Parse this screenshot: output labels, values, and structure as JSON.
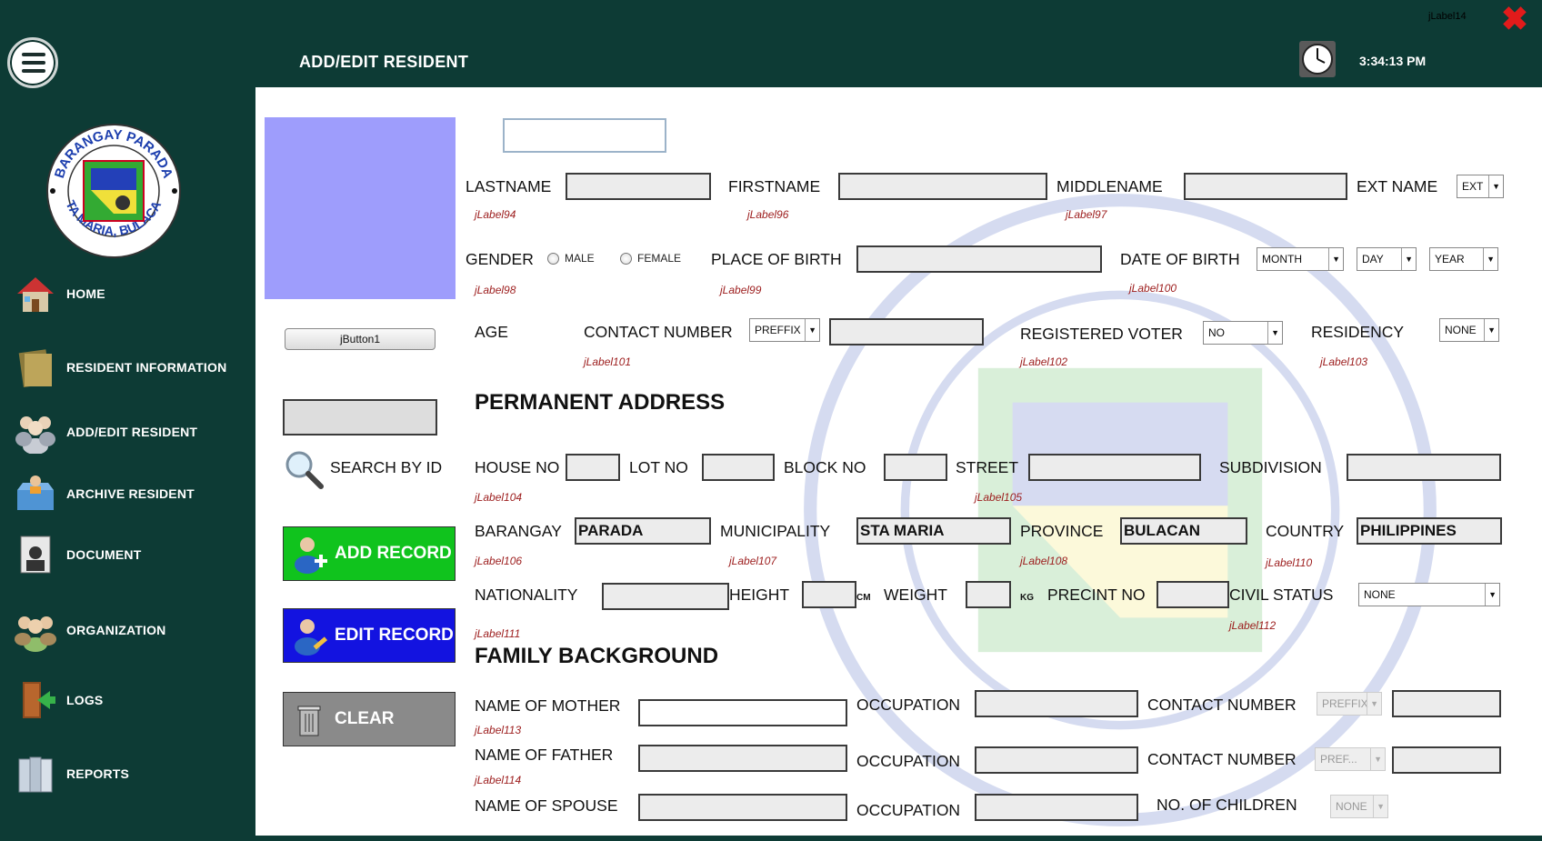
{
  "window": {
    "title": "ADD/EDIT RESIDENT",
    "clock": "3:34:13 PM",
    "corner_label": "jLabel14"
  },
  "logo_text": [
    "BARANGAY PARADA",
    "STA MARIA, BULACAN"
  ],
  "nav": [
    {
      "label": "HOME",
      "icon": "home-icon"
    },
    {
      "label": "RESIDENT INFORMATION",
      "icon": "folder-icon"
    },
    {
      "label": "ADD/EDIT RESIDENT",
      "icon": "users-icon"
    },
    {
      "label": "ARCHIVE RESIDENT",
      "icon": "archive-icon"
    },
    {
      "label": "DOCUMENT",
      "icon": "document-icon"
    },
    {
      "label": "ORGANIZATION",
      "icon": "group-icon"
    },
    {
      "label": "LOGS",
      "icon": "exit-door-icon"
    },
    {
      "label": "REPORTS",
      "icon": "books-icon"
    }
  ],
  "left": {
    "photo_button": "jButton1",
    "search_label": "SEARCH BY ID",
    "add_record": "ADD RECORD",
    "edit_record": "EDIT RECORD",
    "clear": "CLEAR"
  },
  "personal": {
    "lastname": "LASTNAME",
    "firstname": "FIRSTNAME",
    "middlename": "MIDDLENAME",
    "ext_name": "EXT NAME",
    "ext_value": "EXT",
    "jl94": "jLabel94",
    "jl96": "jLabel96",
    "jl97": "jLabel97",
    "gender": "GENDER",
    "male": "MALE",
    "female": "FEMALE",
    "place_of_birth": "PLACE OF BIRTH",
    "date_of_birth": "DATE OF BIRTH",
    "month": "MONTH",
    "day": "DAY",
    "year": "YEAR",
    "jl98": "jLabel98",
    "jl99": "jLabel99",
    "jl100": "jLabel100",
    "age": "AGE",
    "contact_number": "CONTACT NUMBER",
    "prefix": "PREFFIX",
    "registered_voter": "REGISTERED VOTER",
    "voter_value": "NO",
    "residency": "RESIDENCY",
    "residency_value": "NONE",
    "jl101": "jLabel101",
    "jl102": "jLabel102",
    "jl103": "jLabel103"
  },
  "address": {
    "title": "PERMANENT ADDRESS",
    "house_no": "HOUSE NO",
    "lot_no": "LOT NO",
    "block_no": "BLOCK NO",
    "street": "STREET",
    "subdivision": "SUBDIVISION",
    "jl104": "jLabel104",
    "jl105": "jLabel105",
    "barangay": "BARANGAY",
    "barangay_value": "PARADA",
    "municipality": "MUNICIPALITY",
    "municipality_value": "STA MARIA",
    "province": "PROVINCE",
    "province_value": "BULACAN",
    "country": "COUNTRY",
    "country_value": "PHILIPPINES",
    "jl106": "jLabel106",
    "jl107": "jLabel107",
    "jl108": "jLabel108",
    "jl110": "jLabel110",
    "nationality": "NATIONALITY",
    "height": "HEIGHT",
    "cm": "CM",
    "weight": "WEIGHT",
    "kg": "KG",
    "precint_no": "PRECINT NO",
    "civil_status": "CIVIL STATUS",
    "civil_value": "NONE",
    "jl111": "jLabel111",
    "jl112": "jLabel112"
  },
  "family": {
    "title": "FAMILY BACKGROUND",
    "mother": "NAME OF MOTHER",
    "father": "NAME OF FATHER",
    "spouse": "NAME OF SPOUSE",
    "occupation": "OCCUPATION",
    "contact_number": "CONTACT NUMBER",
    "prefix1": "PREFFIX",
    "prefix2": "PREF...",
    "children": "NO. OF CHILDREN",
    "children_value": "NONE",
    "jl113": "jLabel113",
    "jl114": "jLabel114"
  }
}
